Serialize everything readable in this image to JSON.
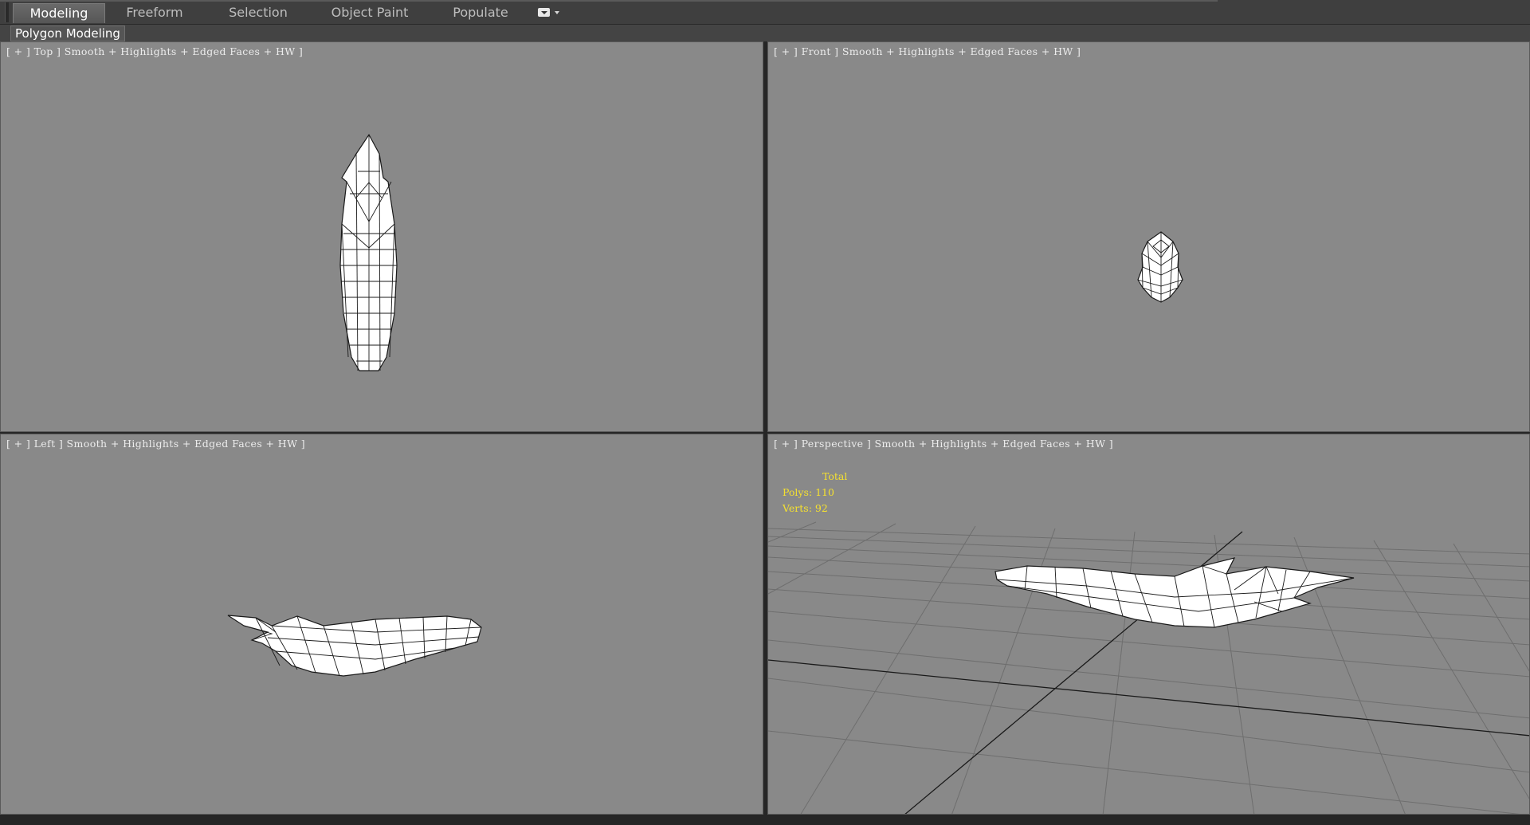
{
  "ribbon": {
    "tabs": [
      {
        "label": "Modeling",
        "active": true
      },
      {
        "label": "Freeform",
        "active": false
      },
      {
        "label": "Selection",
        "active": false
      },
      {
        "label": "Object Paint",
        "active": false
      },
      {
        "label": "Populate",
        "active": false
      }
    ],
    "extra_icon": "dropdown-toggle-icon"
  },
  "panel": {
    "label": "Polygon Modeling"
  },
  "viewports": {
    "top": {
      "plus": "+",
      "view": "Top",
      "shading": "Smooth + Highlights + Edged Faces",
      "mode": "HW"
    },
    "front": {
      "plus": "+",
      "view": "Front",
      "shading": "Smooth + Highlights + Edged Faces",
      "mode": "HW"
    },
    "left": {
      "plus": "+",
      "view": "Left",
      "shading": "Smooth + Highlights + Edged Faces",
      "mode": "HW"
    },
    "perspective": {
      "plus": "+",
      "view": "Perspective",
      "shading": "Smooth + Highlights + Edged Faces",
      "mode": "HW"
    }
  },
  "stats": {
    "heading": "Total",
    "polys": "Polys: 110",
    "verts": "Verts: 92"
  },
  "colors": {
    "viewport_bg": "#898989",
    "stats_text": "#f4e030",
    "mesh_fill": "#ffffff",
    "mesh_wire": "#1a1a1a"
  }
}
